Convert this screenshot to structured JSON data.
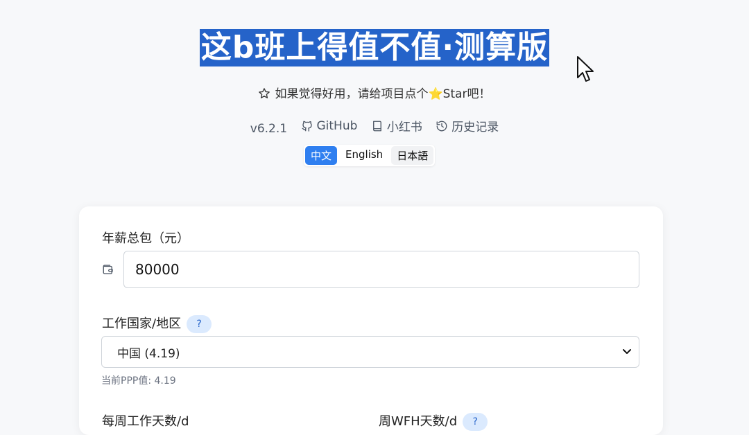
{
  "header": {
    "title": "这b班上得值不值·测算版",
    "star_prompt": "如果觉得好用，请给项目点个⭐Star吧！",
    "version": "v6.2.1",
    "links": [
      {
        "label": "GitHub",
        "icon": "github-icon"
      },
      {
        "label": "小红书",
        "icon": "book-icon"
      },
      {
        "label": "历史记录",
        "icon": "history-icon"
      }
    ],
    "languages": [
      "中文",
      "English",
      "日本語"
    ],
    "active_language": "中文"
  },
  "form": {
    "salary_label": "年薪总包（元）",
    "salary_value": "80000",
    "salary_icon": "wallet-icon",
    "country_label": "工作国家/地区",
    "help_text": "?",
    "country_value": "中国 (4.19)",
    "ppp_note": "当前PPP值: 4.19",
    "workdays_label": "每周工作天数/d",
    "wfh_label": "周WFH天数/d"
  },
  "colors": {
    "title_highlight": "#2563c9",
    "accent": "#2f7ff0",
    "help_badge_bg": "#dbeafe"
  }
}
